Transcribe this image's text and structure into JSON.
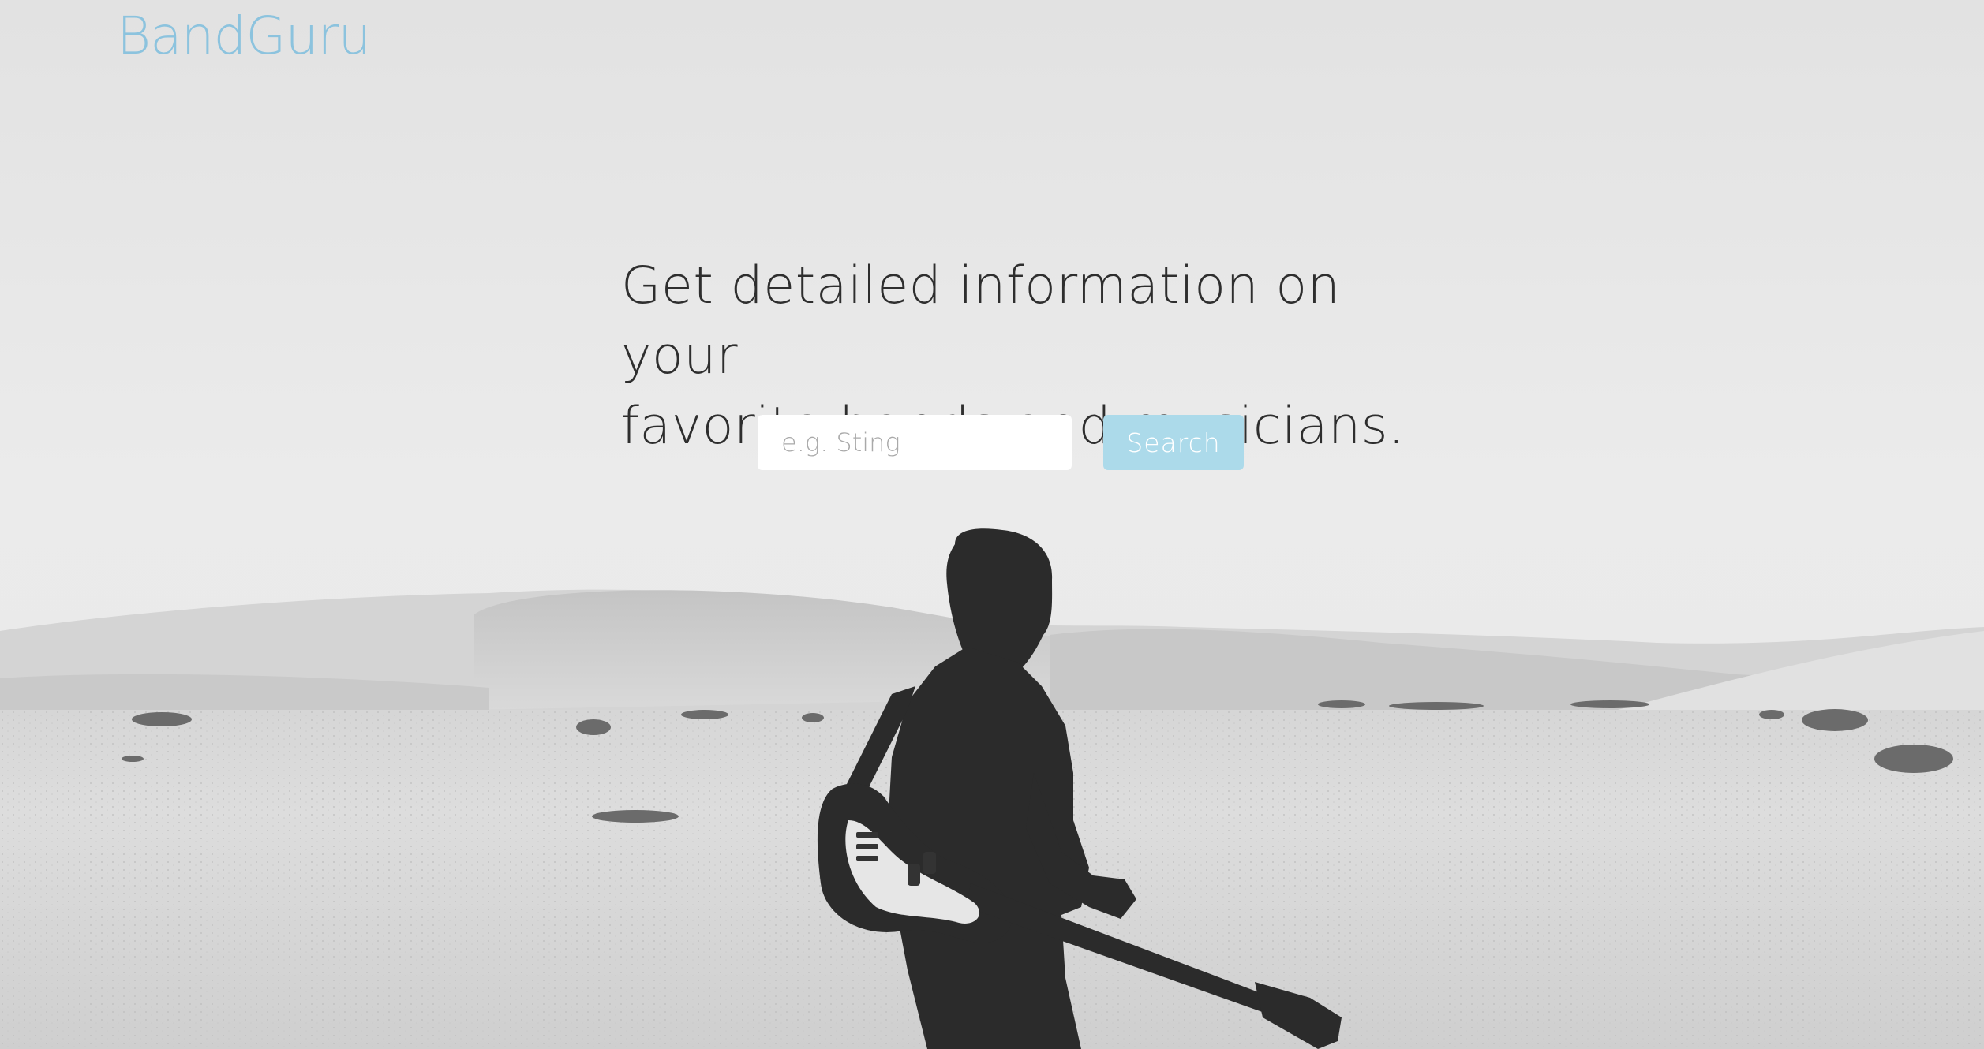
{
  "brand": {
    "name": "BandGuru",
    "color": "#8cc3de"
  },
  "hero": {
    "headline_line1": "Get detailed information on your",
    "headline_line2": "favorite bands and musicians."
  },
  "search": {
    "placeholder": "e.g. Sting",
    "value": "",
    "button_label": "Search",
    "button_color": "#acdaea"
  },
  "background": {
    "icon": "desert-guitarist-photo"
  }
}
